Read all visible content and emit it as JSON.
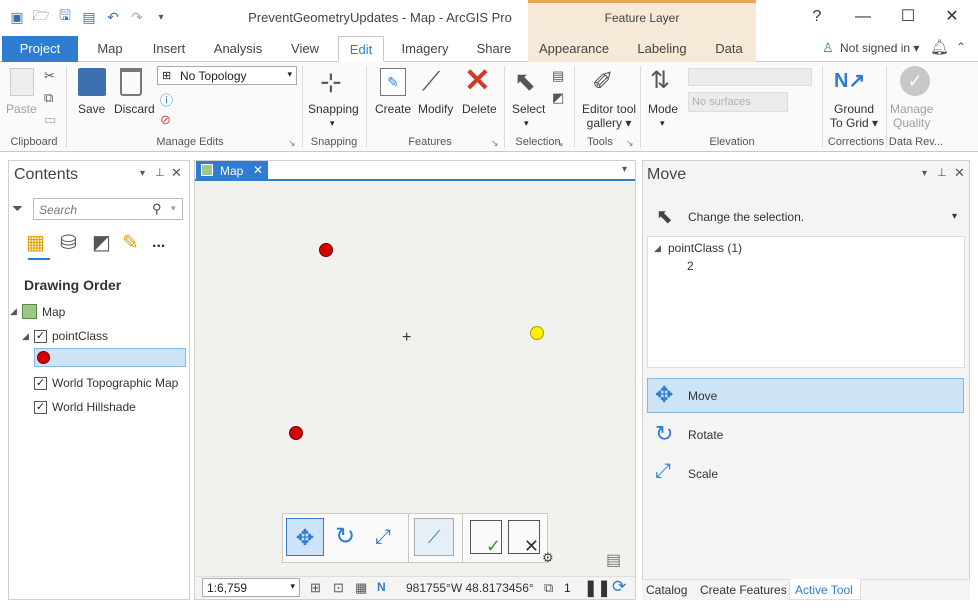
{
  "title": "PreventGeometryUpdates - Map - ArcGIS Pro",
  "context_tab": "Feature Layer",
  "window_controls": {
    "help": "?",
    "minimize": "—",
    "maximize": "☐",
    "close": "✕"
  },
  "tabs": [
    "Project",
    "Map",
    "Insert",
    "Analysis",
    "View",
    "Edit",
    "Imagery",
    "Share",
    "Appearance",
    "Labeling",
    "Data"
  ],
  "account": {
    "label": "Not signed in",
    "caret": "▾"
  },
  "ribbon": {
    "clipboard": {
      "paste": "Paste",
      "group": "Clipboard"
    },
    "manage_edits": {
      "save": "Save",
      "discard": "Discard",
      "topology": "No Topology",
      "group": "Manage Edits"
    },
    "snapping": {
      "label": "Snapping",
      "group": "Snapping"
    },
    "features": {
      "create": "Create",
      "modify": "Modify",
      "delete": "Delete",
      "group": "Features"
    },
    "selection": {
      "select": "Select",
      "group": "Selection"
    },
    "tools": {
      "gallery_line1": "Editor tool",
      "gallery_line2": "gallery",
      "group": "Tools"
    },
    "elevation": {
      "mode": "Mode",
      "surfaces": "No surfaces",
      "group": "Elevation"
    },
    "corrections": {
      "line1": "Ground",
      "line2": "To Grid",
      "group": "Corrections"
    },
    "data_review": {
      "line1": "Manage",
      "line2": "Quality",
      "group": "Data Rev..."
    }
  },
  "contents": {
    "title": "Contents",
    "search_placeholder": "Search",
    "drawing_order": "Drawing Order",
    "map": "Map",
    "layers": [
      "pointClass",
      "World Topographic Map",
      "World Hillshade"
    ],
    "more": "..."
  },
  "map_tab": "Map",
  "status": {
    "scale": "1:6,759",
    "coords": "981755°W 48.8173456°N",
    "selected": "1"
  },
  "move_pane": {
    "title": "Move",
    "change_selection": "Change the selection.",
    "layer": "pointClass (1)",
    "feature_id": "2",
    "tools": [
      "Move",
      "Rotate",
      "Scale"
    ],
    "bottom_tabs": [
      "Catalog",
      "Create Features",
      "Active Tool"
    ]
  },
  "colors": {
    "accent": "#2f7cd0",
    "context": "#f7e9d8",
    "red_point": "#d40000",
    "yellow_point": "#fff000"
  }
}
